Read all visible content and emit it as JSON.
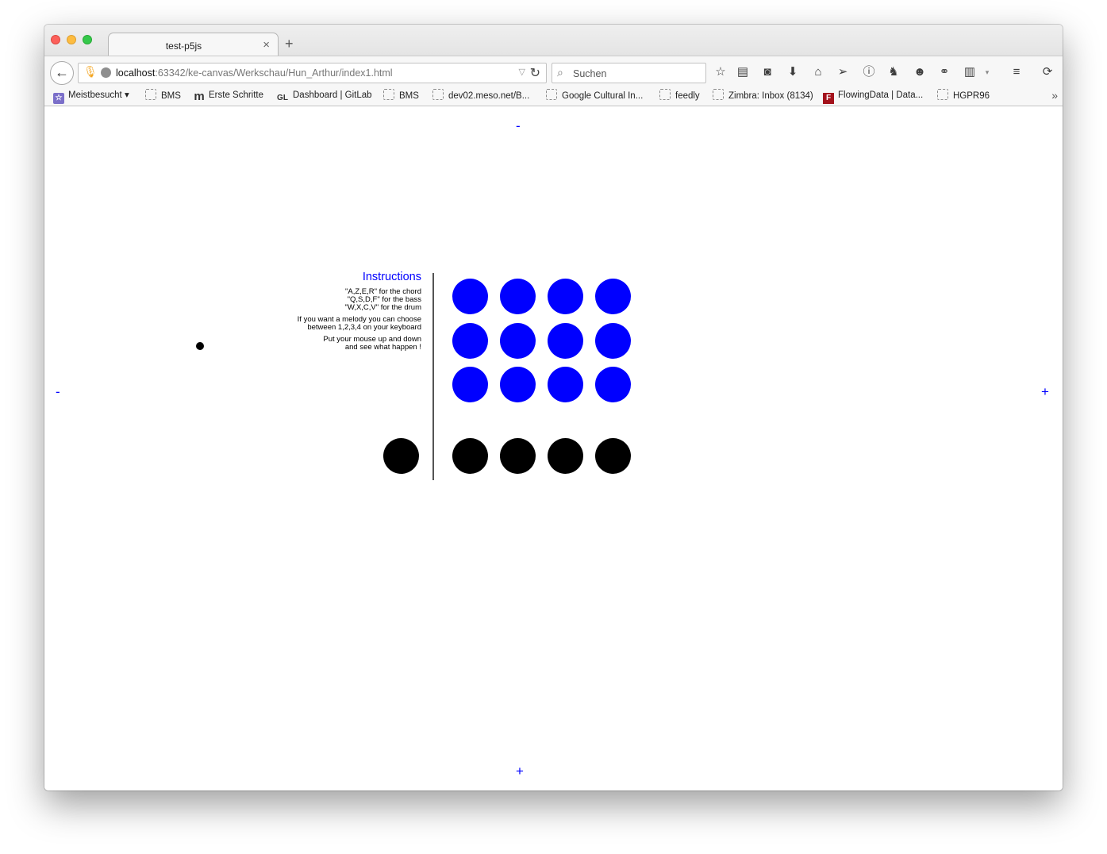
{
  "browser": {
    "tab_title": "test-p5js",
    "tab_close": "×",
    "new_tab": "+",
    "back": "←",
    "url_host": "localhost",
    "url_rest": ":63342/ke-canvas/Werkschau/Hun_Arthur/index1.html",
    "search_placeholder": "Suchen",
    "bookmarks": [
      {
        "label": "Meistbesucht ▾",
        "icon": "folder-icon"
      },
      {
        "label": "BMS",
        "icon": "bookmark-icon"
      },
      {
        "label": "Erste Schritte",
        "icon": "m-logo-icon"
      },
      {
        "label": "Dashboard | GitLab",
        "icon": "gitlab-icon"
      },
      {
        "label": "BMS",
        "icon": "bookmark-icon"
      },
      {
        "label": "dev02.meso.net/B...",
        "icon": "bookmark-icon"
      },
      {
        "label": "Google Cultural In...",
        "icon": "bookmark-icon"
      },
      {
        "label": "feedly",
        "icon": "bookmark-icon"
      },
      {
        "label": "Zimbra: Inbox (8134)",
        "icon": "bookmark-icon"
      },
      {
        "label": "FlowingData | Data...",
        "icon": "flowingdata-icon"
      },
      {
        "label": "HGPR96",
        "icon": "bookmark-icon"
      }
    ]
  },
  "page": {
    "top_control": "-",
    "bottom_control": "+",
    "left_control": "-",
    "right_control": "+",
    "instructions_title": "Instructions",
    "instructions": [
      "\"A,Z,E,R\" for the chord",
      "\"Q,S,D,F\" for the bass",
      "\"W,X,C,V\" for the drum",
      "If you want a melody you can choose",
      "between 1,2,3,4 on your keyboard",
      "Put your mouse up and down",
      "and see what happen !"
    ],
    "pad_rows": 3,
    "pad_columns": 4,
    "drum_count": 5,
    "colors": {
      "pad": "#0000ff",
      "drum": "#000000",
      "controls": "#0000ff",
      "title": "#0000ff"
    }
  }
}
